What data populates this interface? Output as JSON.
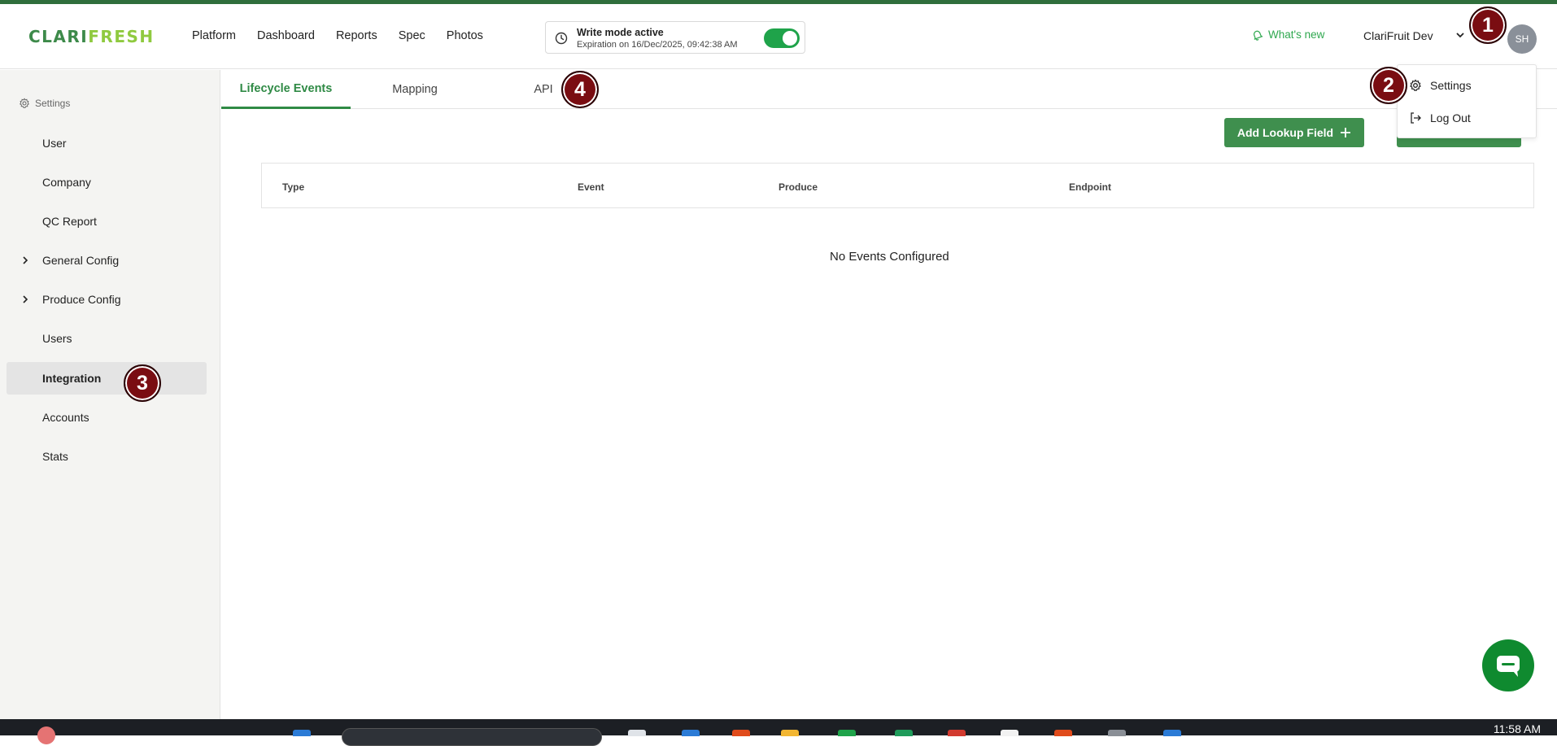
{
  "logo": {
    "part1": "CLARI",
    "part2": "FRESH"
  },
  "nav": [
    "Platform",
    "Dashboard",
    "Reports",
    "Spec",
    "Photos"
  ],
  "write_mode": {
    "title": "Write mode active",
    "expiration": "Expiration on 16/Dec/2025, 09:42:38 AM",
    "enabled": true
  },
  "whats_new": "What's new",
  "account_name": "ClariFruit Dev",
  "avatar_initials": "SH",
  "dropdown": {
    "settings": "Settings",
    "logout": "Log Out"
  },
  "sidebar": {
    "header": "Settings",
    "items": [
      {
        "label": "User"
      },
      {
        "label": "Company"
      },
      {
        "label": "QC Report"
      },
      {
        "label": "General Config",
        "expandable": true
      },
      {
        "label": "Produce Config",
        "expandable": true
      },
      {
        "label": "Users"
      },
      {
        "label": "Integration",
        "active": true
      },
      {
        "label": "Accounts"
      },
      {
        "label": "Stats"
      }
    ]
  },
  "tabs": [
    {
      "label": "Lifecycle Events",
      "active": true
    },
    {
      "label": "Mapping"
    },
    {
      "label": "API"
    }
  ],
  "add_lookup_button": "Add Lookup Field",
  "table": {
    "columns": [
      "Type",
      "Event",
      "Produce",
      "Endpoint"
    ],
    "empty_message": "No Events Configured"
  },
  "markers": [
    "1",
    "2",
    "3",
    "4"
  ],
  "taskbar": {
    "time": "11:58 AM"
  },
  "colors": {
    "brand_green": "#3f8f4e",
    "accent_green": "#2f8a45",
    "marker": "#7a0d12"
  }
}
